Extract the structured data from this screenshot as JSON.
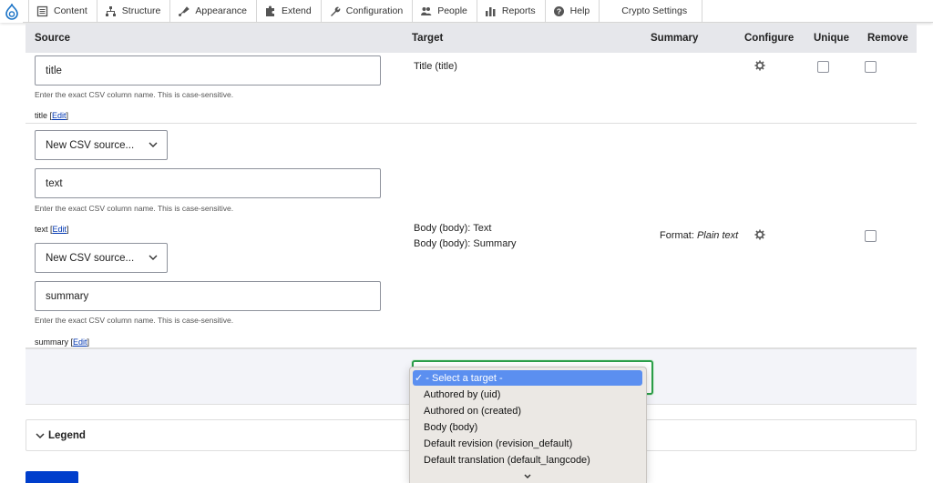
{
  "toolbar": {
    "items": [
      "Content",
      "Structure",
      "Appearance",
      "Extend",
      "Configuration",
      "People",
      "Reports",
      "Help"
    ],
    "crypto": "Crypto Settings"
  },
  "table": {
    "headers": {
      "source": "Source",
      "target": "Target",
      "summary": "Summary",
      "configure": "Configure",
      "unique": "Unique",
      "remove": "Remove"
    },
    "rows": [
      {
        "source_value": "title",
        "hint": "Enter the exact CSV column name. This is case-sensitive.",
        "map_name": "title",
        "edit_label": "Edit",
        "targets": [
          "Title (title)"
        ]
      },
      {
        "select_label": "New CSV source...",
        "source_value": "text",
        "hint": "Enter the exact CSV column name. This is case-sensitive.",
        "map_name": "text",
        "edit_label": "Edit",
        "select_label_2": "New CSV source...",
        "source_value_2": "summary",
        "hint_2": "Enter the exact CSV column name. This is case-sensitive.",
        "map_name_2": "summary",
        "edit_label_2": "Edit",
        "targets": [
          "Body (body): Text",
          "Body (body): Summary"
        ],
        "summary_prefix": "Format: ",
        "summary_value": "Plain text"
      }
    ]
  },
  "dropdown": {
    "options": [
      "✓ - Select a target -",
      "Authored by (uid)",
      "Authored on (created)",
      "Body (body)",
      "Default revision (revision_default)",
      "Default translation (default_langcode)"
    ]
  },
  "legend": {
    "label": "Legend"
  },
  "colors": {
    "primary": "#003ecc",
    "focus": "#2c9f4a",
    "selected_option": "#5b8ff0"
  }
}
